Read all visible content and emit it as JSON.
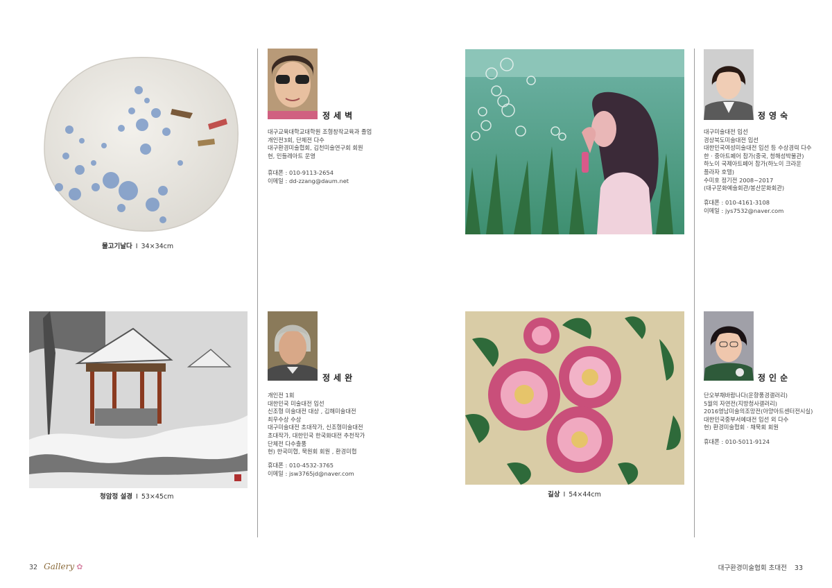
{
  "page_left": {
    "number": "32",
    "brand": "Gallery"
  },
  "page_right": {
    "title": "대구환경미술협회 초대전",
    "number": "33"
  },
  "artworks": [
    {
      "title": "물고기날다",
      "sep": "I",
      "size": "34×34cm"
    },
    {
      "title": "청암정 설경",
      "sep": "I",
      "size": "53×45cm"
    },
    {
      "title": "길상",
      "sep": "I",
      "size": "54×44cm"
    }
  ],
  "artists": [
    {
      "name": "정세벽",
      "bio": "대구교육대학교대학원 조형창작교육과 졸업\n개인전3회, 단체전 다수\n대구환경미술협회, 김천미술연구회 회원\n현, 민들레아트 운영",
      "contact": "휴대폰 : 010-9113-2654\n이메일 : dd-zzang@daum.net"
    },
    {
      "name": "정세완",
      "bio": "개인전 1회\n대한민국 미술대전 입선\n신조형 미술대전 대상 , 김해미술대전\n최우수상 수상\n대구미술대전 초대작가, 신조형미술대전\n초대작가, 대한민국 한국화대전 추천작가\n단체전 다수출품\n현) 한국미협, 묵원회 회원 , 환경미협",
      "contact": "휴대폰 : 010-4532-3765\n이메일 : jsw3765jd@naver.com"
    },
    {
      "name": "정영숙",
      "bio": "대구미술대전 입선\n경상북도미술대전 입선\n대한민국여성미술대전 입선 등 수상경력 다수\n한 · 중아트페어 참가(중국, 청해성박물관)\n하노이 국제아트페어 참가(하노이 크라운\n플라자 호텔)\n수미호 정기전 2008~2017\n(대구문화예술회관/봉산문화회관)",
      "contact": "휴대폰 : 010-4161-3108\n이메일 : jys7532@naver.com"
    },
    {
      "name": "정인순",
      "bio": "단오부채바람나다(운향풍경갤러리)\n5월의 자연전(지방청사갤러리)\n2016영남미술의조망전(아양아트센터전시실)\n대한민국중부서예대전 입선 외 다수\n현) 환경미술협회 · 채묵회 회원",
      "contact": "휴대폰 : 010-5011-9124"
    }
  ],
  "colors": {
    "divider": "#9a9a9a",
    "brand_accent": "#8a6a3a"
  }
}
